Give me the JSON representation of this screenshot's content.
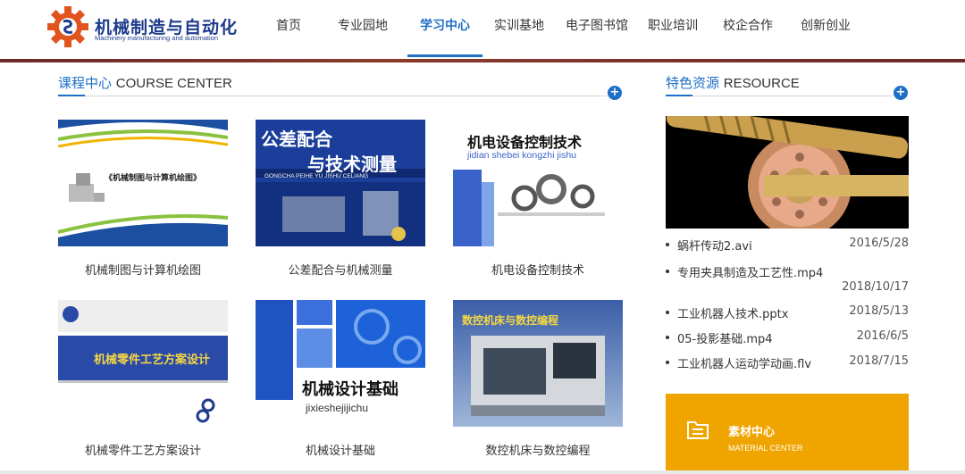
{
  "logo": {
    "title": "机械制造与自动化",
    "subtitle": "Machinery manufacturing and automation",
    "icon": "gear-logo-icon"
  },
  "nav": {
    "active_index": 2,
    "items": [
      {
        "label": "首页"
      },
      {
        "label": "专业园地"
      },
      {
        "label": "学习中心"
      },
      {
        "label": "实训基地"
      },
      {
        "label": "电子图书馆"
      },
      {
        "label": "职业培训"
      },
      {
        "label": "校企合作"
      },
      {
        "label": "创新创业"
      }
    ]
  },
  "course_center": {
    "title_cn": "课程中心",
    "title_en": "COURSE CENTER",
    "more_label": "+",
    "courses": [
      {
        "label": "机械制图与计算机绘图",
        "thumb_text": "《机械制图与计算机绘图》"
      },
      {
        "label": "公差配合与机械测量",
        "thumb_text_1": "公差配合",
        "thumb_text_2": "与技术测量",
        "thumb_text_3": "GONGCHA PEIHE YU JISHU CELIANG"
      },
      {
        "label": "机电设备控制技术",
        "thumb_text_1": "机电设备控制技术",
        "thumb_text_2": "jidian shebei kongzhi jishu"
      },
      {
        "label": "机械零件工艺方案设计",
        "thumb_text": "机械零件工艺方案设计"
      },
      {
        "label": "机械设计基础",
        "thumb_text_1": "机械设计基础",
        "thumb_text_2": "jixieshejijichu"
      },
      {
        "label": "数控机床与数控编程",
        "thumb_text": "数控机床与数控编程"
      }
    ]
  },
  "resource": {
    "title_cn": "特色资源",
    "title_en": "RESOURCE",
    "more_label": "+",
    "items": [
      {
        "name": "蜗杆传动2.avi",
        "date": "2016/5/28"
      },
      {
        "name": "专用夹具制造及工艺性.mp4",
        "date": "2018/10/17"
      },
      {
        "name": "工业机器人技术.pptx",
        "date": "2018/5/13"
      },
      {
        "name": "05-投影基础.mp4",
        "date": "2016/6/5"
      },
      {
        "name": "工业机器人运动学动画.flv",
        "date": "2018/7/15"
      }
    ]
  },
  "material": {
    "title_cn": "素材中心",
    "title_en": "MATERIAL CENTER",
    "icon": "folder-list-icon"
  },
  "colors": {
    "accent": "#1e6fc6",
    "brand": "#1f3c8c",
    "material_bg": "#f0a400",
    "stripe": "#7a3030"
  }
}
